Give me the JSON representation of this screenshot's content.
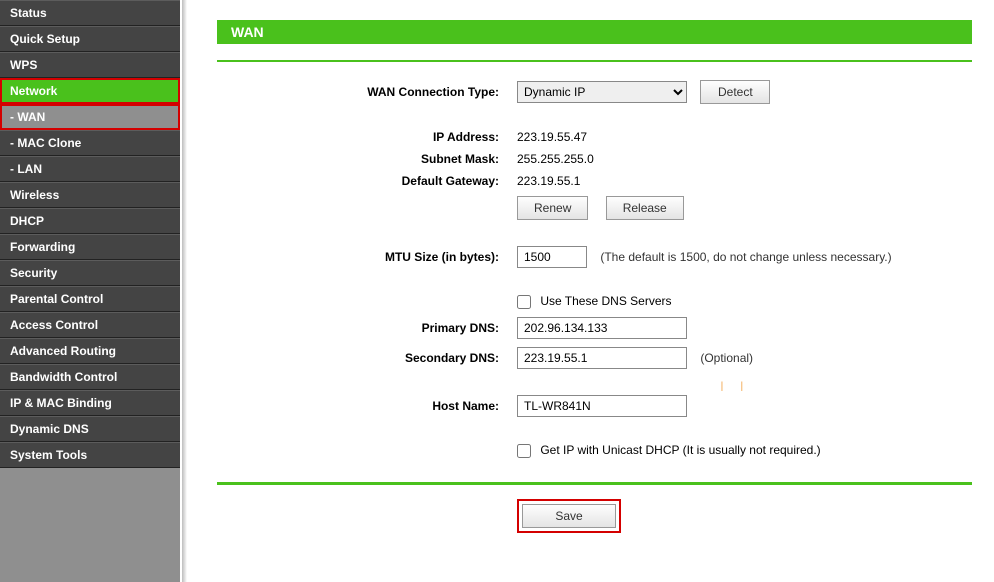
{
  "sidebar": {
    "items": [
      {
        "label": "Status"
      },
      {
        "label": "Quick Setup"
      },
      {
        "label": "WPS"
      },
      {
        "label": "Network",
        "selected": true,
        "highlight": true
      },
      {
        "label": "- WAN",
        "sub": true,
        "selected": true,
        "highlight": true
      },
      {
        "label": "- MAC Clone",
        "sub": true
      },
      {
        "label": "- LAN",
        "sub": true
      },
      {
        "label": "Wireless"
      },
      {
        "label": "DHCP"
      },
      {
        "label": "Forwarding"
      },
      {
        "label": "Security"
      },
      {
        "label": "Parental Control"
      },
      {
        "label": "Access Control"
      },
      {
        "label": "Advanced Routing"
      },
      {
        "label": "Bandwidth Control"
      },
      {
        "label": "IP & MAC Binding"
      },
      {
        "label": "Dynamic DNS"
      },
      {
        "label": "System Tools"
      }
    ]
  },
  "page": {
    "title": "WAN"
  },
  "labels": {
    "wan_conn_type": "WAN Connection Type:",
    "detect": "Detect",
    "ip_address": "IP Address:",
    "subnet_mask": "Subnet Mask:",
    "default_gateway": "Default Gateway:",
    "renew": "Renew",
    "release": "Release",
    "mtu": "MTU Size (in bytes):",
    "mtu_hint": "(The default is 1500, do not change unless necessary.)",
    "use_dns": "Use These DNS Servers",
    "primary_dns": "Primary DNS:",
    "secondary_dns": "Secondary DNS:",
    "optional": "(Optional)",
    "host_name": "Host Name:",
    "unicast": "Get IP with Unicast DHCP (It is usually not required.)",
    "save": "Save"
  },
  "values": {
    "wan_conn_type": "Dynamic IP",
    "ip_address": "223.19.55.47",
    "subnet_mask": "255.255.255.0",
    "default_gateway": "223.19.55.1",
    "mtu": "1500",
    "primary_dns": "202.96.134.133",
    "secondary_dns": "223.19.55.1",
    "host_name": "TL-WR841N",
    "use_dns": false,
    "unicast": false
  }
}
